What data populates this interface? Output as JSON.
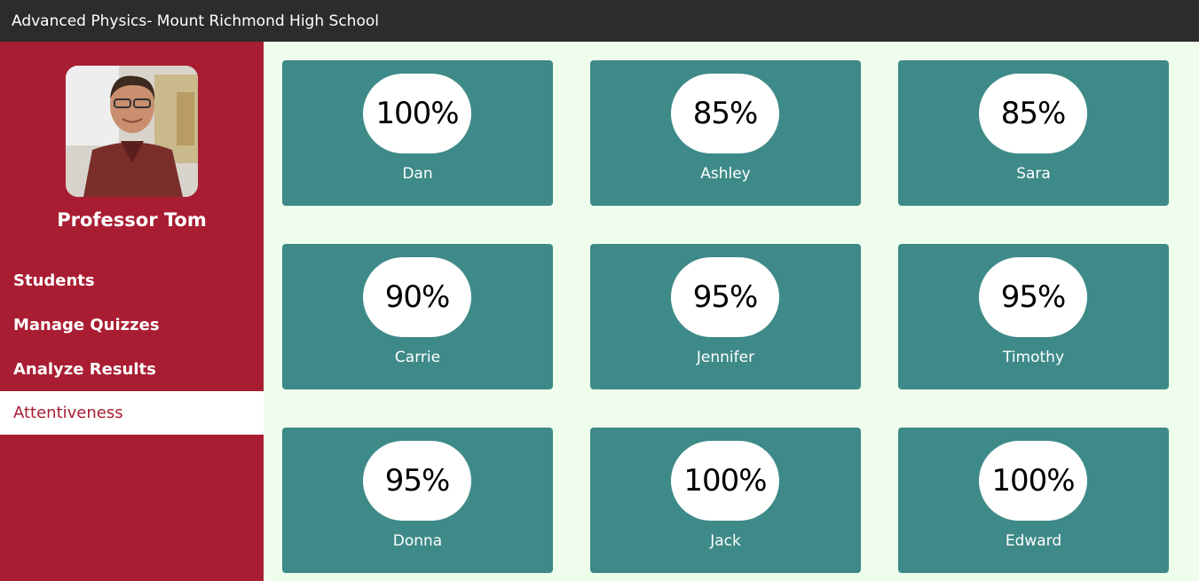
{
  "header": {
    "title": "Advanced Physics- Mount Richmond High School"
  },
  "sidebar": {
    "profile_name": "Professor Tom",
    "nav": [
      {
        "label": "Students",
        "active": false
      },
      {
        "label": "Manage Quizzes",
        "active": false
      },
      {
        "label": "Analyze Results",
        "active": false
      },
      {
        "label": "Attentiveness",
        "active": true
      }
    ]
  },
  "students": [
    {
      "name": "Dan",
      "score": "100%"
    },
    {
      "name": "Ashley",
      "score": "85%"
    },
    {
      "name": "Sara",
      "score": "85%"
    },
    {
      "name": "Carrie",
      "score": "90%"
    },
    {
      "name": "Jennifer",
      "score": "95%"
    },
    {
      "name": "Timothy",
      "score": "95%"
    },
    {
      "name": "Donna",
      "score": "95%"
    },
    {
      "name": "Jack",
      "score": "100%"
    },
    {
      "name": "Edward",
      "score": "100%"
    }
  ],
  "colors": {
    "topbar": "#2b2d2a",
    "sidebar": "#a91d32",
    "card": "#3e8a88",
    "background": "#eefdec"
  }
}
